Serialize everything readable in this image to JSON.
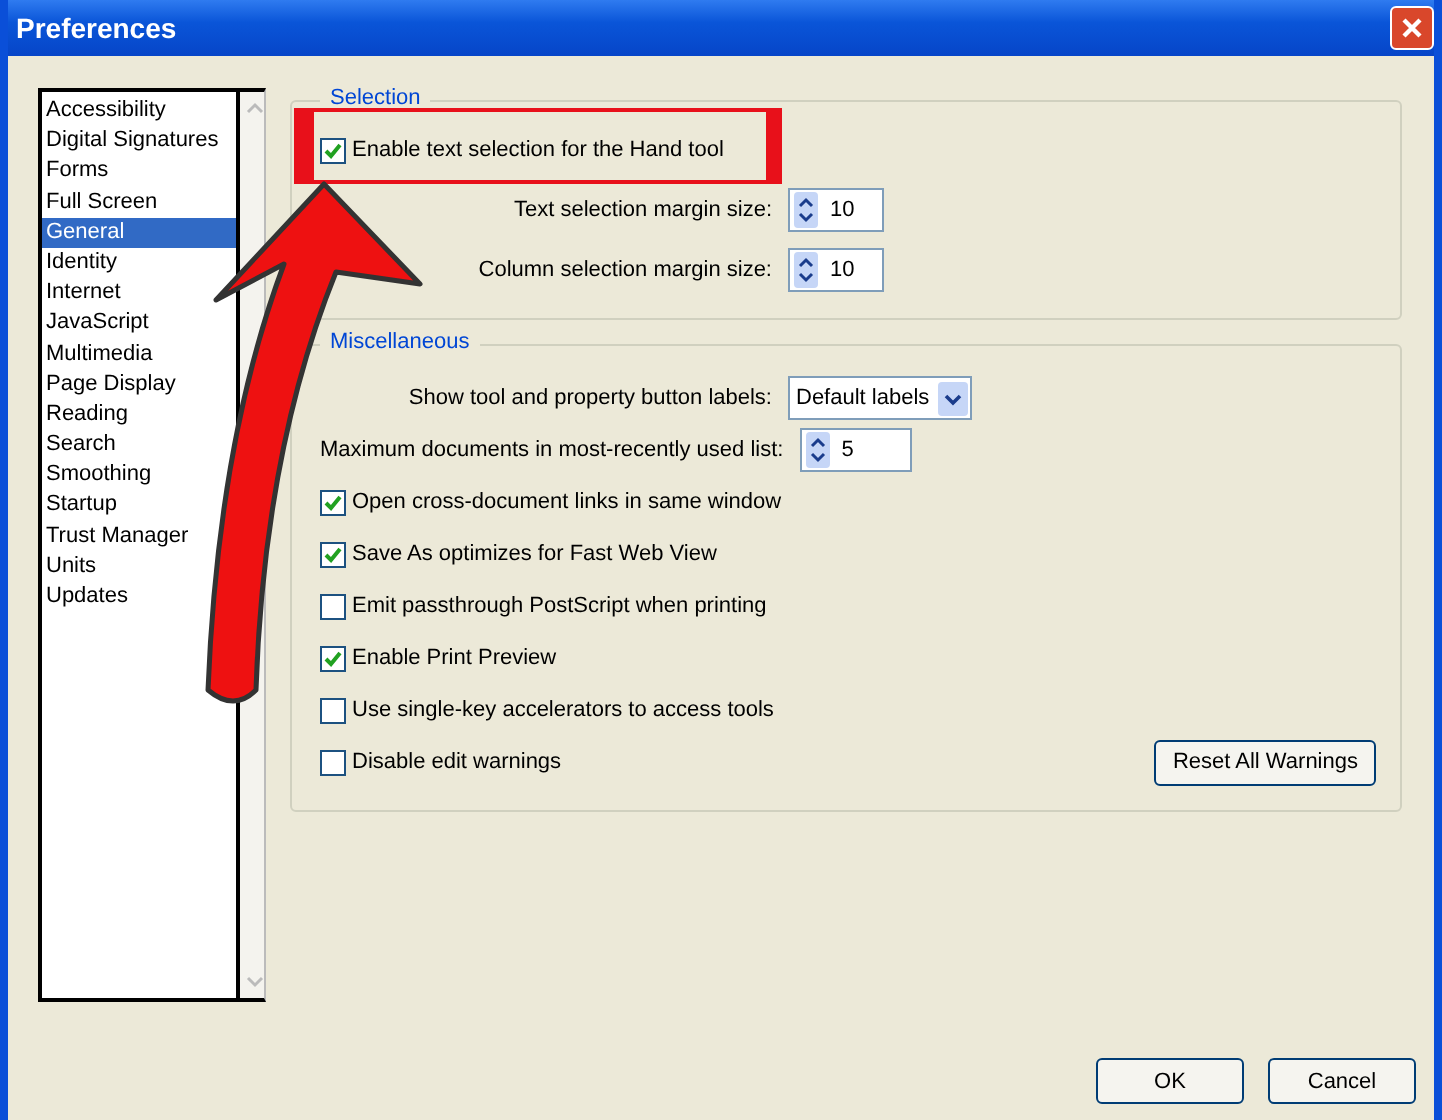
{
  "window": {
    "title": "Preferences"
  },
  "categories": [
    {
      "label": "Accessibility",
      "selected": false
    },
    {
      "label": "Digital Signatures",
      "selected": false
    },
    {
      "label": "Forms",
      "selected": false
    },
    {
      "label": "Full Screen",
      "selected": false
    },
    {
      "label": "General",
      "selected": true
    },
    {
      "label": "Identity",
      "selected": false
    },
    {
      "label": "Internet",
      "selected": false
    },
    {
      "label": "JavaScript",
      "selected": false
    },
    {
      "label": "Multimedia",
      "selected": false
    },
    {
      "label": "Page Display",
      "selected": false
    },
    {
      "label": "Reading",
      "selected": false
    },
    {
      "label": "Search",
      "selected": false
    },
    {
      "label": "Smoothing",
      "selected": false
    },
    {
      "label": "Startup",
      "selected": false
    },
    {
      "label": "Trust Manager",
      "selected": false
    },
    {
      "label": "Units",
      "selected": false
    },
    {
      "label": "Updates",
      "selected": false
    }
  ],
  "selection": {
    "title": "Selection",
    "items": [
      {
        "kind": "checkbox",
        "label": "Enable text selection for the Hand tool",
        "checked": true
      },
      {
        "kind": "spinner",
        "label": "Text selection margin size:",
        "value": "10"
      },
      {
        "kind": "spinner",
        "label": "Column selection margin size:",
        "value": "10"
      }
    ]
  },
  "miscellaneous": {
    "title": "Miscellaneous",
    "items": [
      {
        "kind": "select",
        "label": "Show tool and property button labels:",
        "value": "Default labels"
      },
      {
        "kind": "spinner",
        "label": "Maximum documents in most-recently used list:",
        "value": "5"
      },
      {
        "kind": "checkbox",
        "label": "Open cross-document links in same window",
        "checked": true
      },
      {
        "kind": "checkbox",
        "label": "Save As optimizes for Fast Web View",
        "checked": true
      },
      {
        "kind": "checkbox",
        "label": "Emit passthrough PostScript when printing",
        "checked": false
      },
      {
        "kind": "checkbox",
        "label": "Enable Print Preview",
        "checked": true
      },
      {
        "kind": "checkbox",
        "label": "Use single-key accelerators to access tools",
        "checked": false
      },
      {
        "kind": "checkbox",
        "label": "Disable edit warnings",
        "checked": false,
        "button": "Reset All Warnings"
      }
    ]
  },
  "buttons": [
    "OK",
    "Cancel"
  ]
}
